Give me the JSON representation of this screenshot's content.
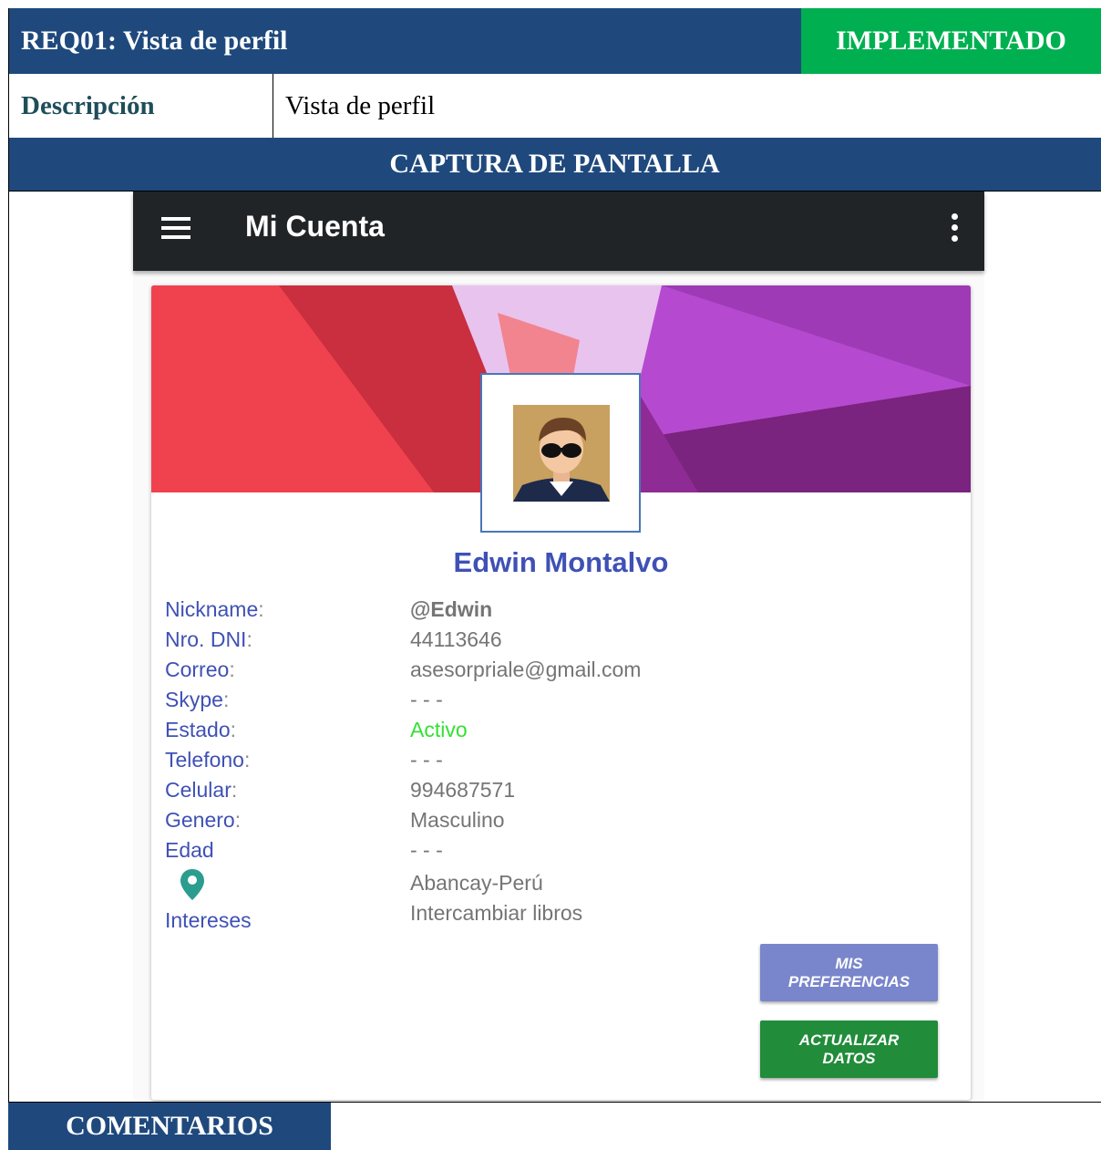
{
  "header": {
    "title": "REQ01: Vista de perfil",
    "status": "IMPLEMENTADO",
    "status_color": "#00b050",
    "bar_color": "#1f497d"
  },
  "description": {
    "label": "Descripción",
    "value": "Vista de perfil"
  },
  "capture_header": "CAPTURA DE PANTALLA",
  "app": {
    "toolbar_title": "Mi Cuenta",
    "menu_icon": "hamburger-menu-icon",
    "overflow_icon": "more-vert-icon",
    "profile_name": "Edwin Montalvo",
    "fields": [
      {
        "label": "Nickname",
        "sep": ":",
        "value": "@Edwin"
      },
      {
        "label": "Nro. DNI",
        "sep": ":",
        "value": "44113646"
      },
      {
        "label": "Correo",
        "sep": ":",
        "value": "asesorpriale@gmail.com"
      },
      {
        "label": "Skype",
        "sep": ":",
        "value": "- - -"
      },
      {
        "label": "Estado",
        "sep": ":",
        "value": "Activo",
        "value_color": "#33e133"
      },
      {
        "label": "Telefono",
        "sep": ":",
        "value": "- - -"
      },
      {
        "label": "Celular",
        "sep": ":",
        "value": "994687571"
      },
      {
        "label": "Genero",
        "sep": ":",
        "value": "Masculino"
      },
      {
        "label": "Edad",
        "sep": "",
        "value": "- - -"
      }
    ],
    "location_icon": "location-pin-icon",
    "location_value": "Abancay-Perú",
    "intereses_label": "Intereses",
    "intereses_value": "Intercambiar libros",
    "btn_prefs_line1": "MIS",
    "btn_prefs_line2": "PREFERENCIAS",
    "btn_update_line1": "ACTUALIZAR",
    "btn_update_line2": "DATOS"
  },
  "comments_header": "COMENTARIOS"
}
